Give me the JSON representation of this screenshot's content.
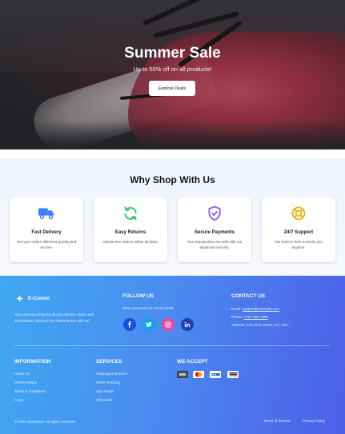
{
  "hero": {
    "title": "Summer Sale",
    "subtitle": "Up to 50% off on all products!",
    "cta_label": "Explore Deals"
  },
  "why": {
    "title": "Why Shop With Us",
    "features": [
      {
        "title": "Fast Delivery",
        "desc": "Get your orders delivered quickly and on time.",
        "icon": "truck-icon",
        "color": "#3b82f6"
      },
      {
        "title": "Easy Returns",
        "desc": "Hassle-free returns within 30 days.",
        "icon": "refresh-icon",
        "color": "#22c55e"
      },
      {
        "title": "Secure Payments",
        "desc": "Your transactions are safe with our advanced security.",
        "icon": "shield-icon",
        "color": "#8b5cf6"
      },
      {
        "title": "24/7 Support",
        "desc": "Our team is here to assist you anytime.",
        "icon": "lifebuoy-icon",
        "color": "#eab308"
      }
    ]
  },
  "footer": {
    "brand": "E-Comm",
    "about": "Your one-stop shop for all your favorite shoes and accessories. Discover the latest trends with us!",
    "follow": {
      "title": "FOLLOW US",
      "text": "Stay connected on social media.",
      "networks": [
        {
          "name": "facebook",
          "label": "f",
          "color": "#1d4ed8"
        },
        {
          "name": "twitter",
          "label": "t",
          "color": "#0ea5e9"
        },
        {
          "name": "instagram",
          "label": "ig",
          "color": "#ec4899"
        },
        {
          "name": "linkedin",
          "label": "in",
          "color": "#1e40af"
        }
      ]
    },
    "contact": {
      "title": "CONTACT US",
      "email_label": "Email:",
      "email": "support@example.com",
      "phone_label": "Phone:",
      "phone": "+123 456 7890",
      "address": "Address: 123 Shoe Street, NY, USA"
    },
    "information": {
      "title": "INFORMATION",
      "links": [
        "About Us",
        "Privacy Policy",
        "Terms & Conditions",
        "FAQs"
      ]
    },
    "services": {
      "title": "SERVICES",
      "links": [
        "Shipping & Returns",
        "Order Tracking",
        "Size Guide",
        "Gift Cards"
      ]
    },
    "payments": {
      "title": "WE ACCEPT",
      "methods": [
        "amex",
        "mastercard",
        "paypal",
        "visa"
      ]
    },
    "copyright": "© 2024 ShoeStore. All rights reserved.",
    "legal": [
      "Terms of Service",
      "Privacy Policy"
    ]
  }
}
